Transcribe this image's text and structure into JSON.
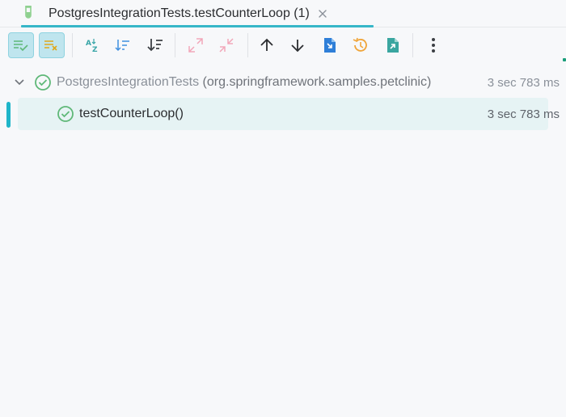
{
  "tab": {
    "title": "PostgresIntegrationTests.testCounterLoop (1)",
    "icon": "test-flask-icon",
    "accent_color": "#36b6c8"
  },
  "toolbar": {
    "buttons": [
      {
        "name": "show-passed-button",
        "icon": "list-check-icon",
        "active": true,
        "color": "#5fb878"
      },
      {
        "name": "show-ignored-button",
        "icon": "list-x-icon",
        "active": true,
        "color": "#e0a818"
      },
      {
        "name": "sort-alphabetically-button",
        "icon": "sort-az-icon",
        "active": false,
        "color": "#3aa6a8"
      },
      {
        "name": "sort-by-duration-button",
        "icon": "sort-duration-icon",
        "active": false,
        "color": "#3f8fe0"
      },
      {
        "name": "sort-down-button",
        "icon": "sort-down-icon",
        "active": false,
        "color": "#3c3f44"
      },
      {
        "name": "expand-all-button",
        "icon": "expand-icon",
        "active": false,
        "color": "#f2a7b9"
      },
      {
        "name": "collapse-all-button",
        "icon": "collapse-icon",
        "active": false,
        "color": "#f2a7b9"
      },
      {
        "name": "previous-failed-button",
        "icon": "arrow-up-icon",
        "active": false,
        "color": "#2b2d30"
      },
      {
        "name": "next-failed-button",
        "icon": "arrow-down-icon",
        "active": false,
        "color": "#2b2d30"
      },
      {
        "name": "import-tests-button",
        "icon": "import-icon",
        "active": false,
        "color": "#2f7fd8"
      },
      {
        "name": "test-history-button",
        "icon": "history-icon",
        "active": false,
        "color": "#f0a53a"
      },
      {
        "name": "export-tests-button",
        "icon": "export-icon",
        "active": false,
        "color": "#3aa6a0"
      },
      {
        "name": "more-options-button",
        "icon": "more-vertical-icon",
        "active": false,
        "color": "#3c3f44"
      }
    ]
  },
  "tree": {
    "root": {
      "class_name": "PostgresIntegrationTests",
      "package": "(org.springframework.samples.petclinic)",
      "duration": "3 sec 783 ms",
      "status": "passed",
      "expanded": true
    },
    "children": [
      {
        "name": "testCounterLoop()",
        "duration": "3 sec 783 ms",
        "status": "passed",
        "selected": true
      }
    ]
  },
  "colors": {
    "passed": "#5fb878",
    "selection_bg": "#e6f3f4",
    "focus_bar": "#1fb5c9"
  }
}
